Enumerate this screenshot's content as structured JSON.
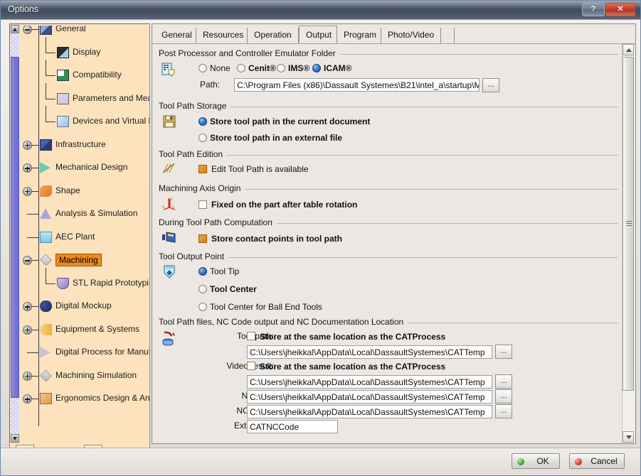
{
  "window": {
    "title": "Options",
    "help_button": "?",
    "close_button": "✕"
  },
  "sidebar": {
    "nodes": [
      {
        "label": "General",
        "icon": "general-icon",
        "level": 0,
        "expander": "minus",
        "selected": false
      },
      {
        "label": "Display",
        "icon": "display-icon",
        "level": 1,
        "expander": "none",
        "selected": false
      },
      {
        "label": "Compatibility",
        "icon": "compatibility-icon",
        "level": 1,
        "expander": "none",
        "selected": false
      },
      {
        "label": "Parameters and Measu",
        "icon": "parameters-icon",
        "level": 1,
        "expander": "none",
        "selected": false
      },
      {
        "label": "Devices and Virtual Rea",
        "icon": "devices-icon",
        "level": 1,
        "expander": "none",
        "selected": false
      },
      {
        "label": "Infrastructure",
        "icon": "infrastructure-icon",
        "level": 0,
        "expander": "plus",
        "selected": false
      },
      {
        "label": "Mechanical Design",
        "icon": "mechanical-design-icon",
        "level": 0,
        "expander": "plus",
        "selected": false
      },
      {
        "label": "Shape",
        "icon": "shape-icon",
        "level": 0,
        "expander": "plus",
        "selected": false
      },
      {
        "label": "Analysis & Simulation",
        "icon": "analysis-icon",
        "level": 0,
        "expander": "none",
        "selected": false
      },
      {
        "label": "AEC Plant",
        "icon": "aec-plant-icon",
        "level": 0,
        "expander": "none",
        "selected": false
      },
      {
        "label": "Machining",
        "icon": "machining-icon",
        "level": 0,
        "expander": "minus",
        "selected": true
      },
      {
        "label": "STL Rapid Prototyping",
        "icon": "stl-rapid-prototyping-icon",
        "level": 1,
        "expander": "none",
        "selected": false
      },
      {
        "label": "Digital Mockup",
        "icon": "digital-mockup-icon",
        "level": 0,
        "expander": "plus",
        "selected": false
      },
      {
        "label": "Equipment & Systems",
        "icon": "equipment-systems-icon",
        "level": 0,
        "expander": "plus",
        "selected": false
      },
      {
        "label": "Digital Process for Manufa",
        "icon": "digital-process-icon",
        "level": 0,
        "expander": "none",
        "selected": false
      },
      {
        "label": "Machining Simulation",
        "icon": "machining-simulation-icon",
        "level": 0,
        "expander": "plus",
        "selected": false
      },
      {
        "label": "Ergonomics Design & Ana",
        "icon": "ergonomics-icon",
        "level": 0,
        "expander": "plus",
        "selected": false
      }
    ],
    "bottom_buttons": [
      {
        "name": "home-options-button",
        "icon": "wrench-house-icon"
      },
      {
        "name": "document-options-button",
        "icon": "wrench-document-icon"
      }
    ]
  },
  "tabs": [
    {
      "label": "General",
      "active": false
    },
    {
      "label": "Resources",
      "active": false
    },
    {
      "label": "Operation",
      "active": false
    },
    {
      "label": "Output",
      "active": true
    },
    {
      "label": "Program",
      "active": false
    },
    {
      "label": "Photo/Video",
      "active": false
    }
  ],
  "sections": {
    "post_processor": {
      "title": "Post Processor and Controller Emulator Folder",
      "icon": "post-processor-icon",
      "radios": [
        {
          "label": "None",
          "checked": false,
          "bold": false
        },
        {
          "label": "Cenit®",
          "checked": false,
          "bold": true
        },
        {
          "label": "IMS®",
          "checked": false,
          "bold": true
        },
        {
          "label": "ICAM®",
          "checked": true,
          "bold": true
        }
      ],
      "path_label": "Path:",
      "path_value": "C:\\Program Files (x86)\\Dassault Systemes\\B21\\intel_a\\startup\\M",
      "browse_label": "..."
    },
    "tool_path_storage": {
      "title": "Tool Path Storage",
      "icon": "floppy-disk-icon",
      "radios": [
        {
          "label": "Store tool path in the current document",
          "checked": true,
          "bold": true
        },
        {
          "label": "Store tool path in an external file",
          "checked": false,
          "bold": true
        }
      ]
    },
    "tool_path_edition": {
      "title": "Tool Path Edition",
      "icon": "tool-path-edition-icon",
      "checkbox": {
        "label": "Edit Tool Path is available",
        "checked": true,
        "bold": false
      }
    },
    "machining_axis_origin": {
      "title": "Machining Axis Origin",
      "icon": "axis-origin-icon",
      "checkbox": {
        "label": "Fixed on the part after table rotation",
        "checked": false,
        "bold": true
      }
    },
    "during_tool_path_computation": {
      "title": "During Tool Path Computation",
      "icon": "computation-icon",
      "checkbox": {
        "label": "Store contact points in tool path",
        "checked": true,
        "bold": true
      }
    },
    "tool_output_point": {
      "title": "Tool Output Point",
      "icon": "tool-output-icon",
      "radios": [
        {
          "label": "Tool Tip",
          "checked": true,
          "bold": false
        },
        {
          "label": "Tool Center",
          "checked": false,
          "bold": true
        },
        {
          "label": "Tool Center for Ball End Tools",
          "checked": false,
          "bold": false
        }
      ]
    },
    "file_locations": {
      "title": "Tool Path files, NC Code output and NC Documentation Location",
      "icon": "file-location-icon",
      "rows": [
        {
          "label": "Tool path:",
          "checkbox_label": "Store at the same location as the CATProcess",
          "checked": false,
          "value": "C:\\Users\\jheikkal\\AppData\\Local\\DassaultSystemes\\CATTemp",
          "browse": "..."
        },
        {
          "label": "Video result:",
          "checkbox_label": "Store at the same location as the CATProcess",
          "checked": false,
          "value": "C:\\Users\\jheikkal\\AppData\\Local\\DassaultSystemes\\CATTemp",
          "browse": "..."
        },
        {
          "label": "NC Doc:",
          "checkbox_label": null,
          "checked": null,
          "value": "C:\\Users\\jheikkal\\AppData\\Local\\DassaultSystemes\\CATTemp",
          "browse": "..."
        },
        {
          "label": "NC Code:",
          "checkbox_label": null,
          "checked": null,
          "value": "C:\\Users\\jheikkal\\AppData\\Local\\DassaultSystemes\\CATTemp",
          "browse": "..."
        },
        {
          "label": "Extension:",
          "checkbox_label": null,
          "checked": null,
          "value": "CATNCCode",
          "browse": null
        }
      ]
    }
  },
  "footer": {
    "ok_label": "OK",
    "cancel_label": "Cancel"
  },
  "colors": {
    "tree_background": "#fde3bd",
    "panel_background": "#ece7e3",
    "selection": "#eb8920",
    "radio_on": "#1b4f9c",
    "checkbox_on": "#d97f16",
    "titlebar": "#4b5667",
    "close_button": "#c43b28"
  }
}
